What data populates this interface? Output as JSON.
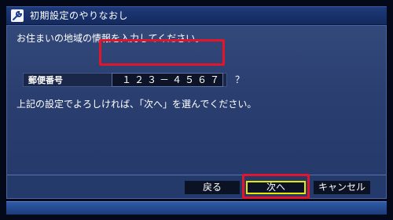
{
  "window": {
    "title": "初期設定のやりなおし",
    "icon": "wrench-icon"
  },
  "prompt": "お住まいの地域の情報を入力してください。",
  "postal_field": {
    "label": "郵便番号",
    "value": "１２３－４５６７",
    "help": "？"
  },
  "confirm_text": "上記の設定でよろしければ、「次へ」を選んでください。",
  "buttons": {
    "back": "戻る",
    "next": "次へ",
    "cancel": "キャンセル"
  },
  "colors": {
    "highlight_outline": "#e2152a",
    "focus_border": "#e8e800",
    "panel": "#2a3f70"
  }
}
